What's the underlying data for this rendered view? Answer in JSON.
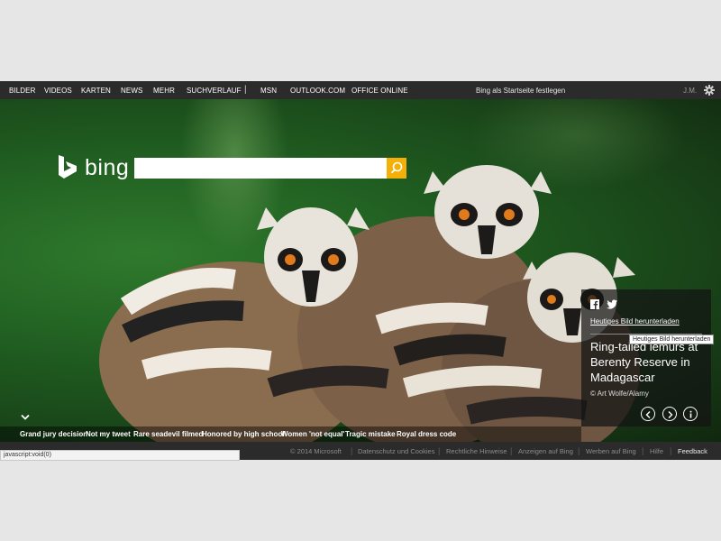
{
  "topnav": {
    "items": [
      "BILDER",
      "VIDEOS",
      "KARTEN",
      "NEWS",
      "MEHR",
      "SUCHVERLAUF"
    ],
    "separator": "|",
    "items_right": [
      "MSN",
      "OUTLOOK.COM",
      "OFFICE ONLINE"
    ],
    "startpage": "Bing als Startseite festlegen",
    "user": "J.M.",
    "settings_icon": "gear-icon"
  },
  "logo": {
    "text": "bing",
    "icon": "bing-b-icon"
  },
  "search": {
    "value": "",
    "button_icon": "search-icon",
    "accent": "#f2b008"
  },
  "info": {
    "share_icons": [
      "facebook-icon",
      "twitter-icon"
    ],
    "download_label": "Heutiges Bild herunterladen",
    "tooltip": "Heutiges Bild herunterladen",
    "title": "Ring-tailed lemurs at Berenty Reserve in Madagascar",
    "copyright": "© Art Wolfe/Alamy",
    "controls": [
      "previous-icon",
      "next-icon",
      "info-icon"
    ]
  },
  "news": [
    "Grand jury decision",
    "Not my tweet",
    "Rare seadevil filmed",
    "Honored by high school",
    "Women 'not equal'",
    "Tragic mistake",
    "Royal dress code"
  ],
  "footer": {
    "copyright": "© 2014 Microsoft",
    "links": [
      "Datenschutz und Cookies",
      "Rechtliche Hinweise",
      "Anzeigen auf Bing",
      "Werben auf Bing",
      "Hilfe"
    ],
    "feedback": "Feedback"
  },
  "statusbar": "javascript:void(0)"
}
